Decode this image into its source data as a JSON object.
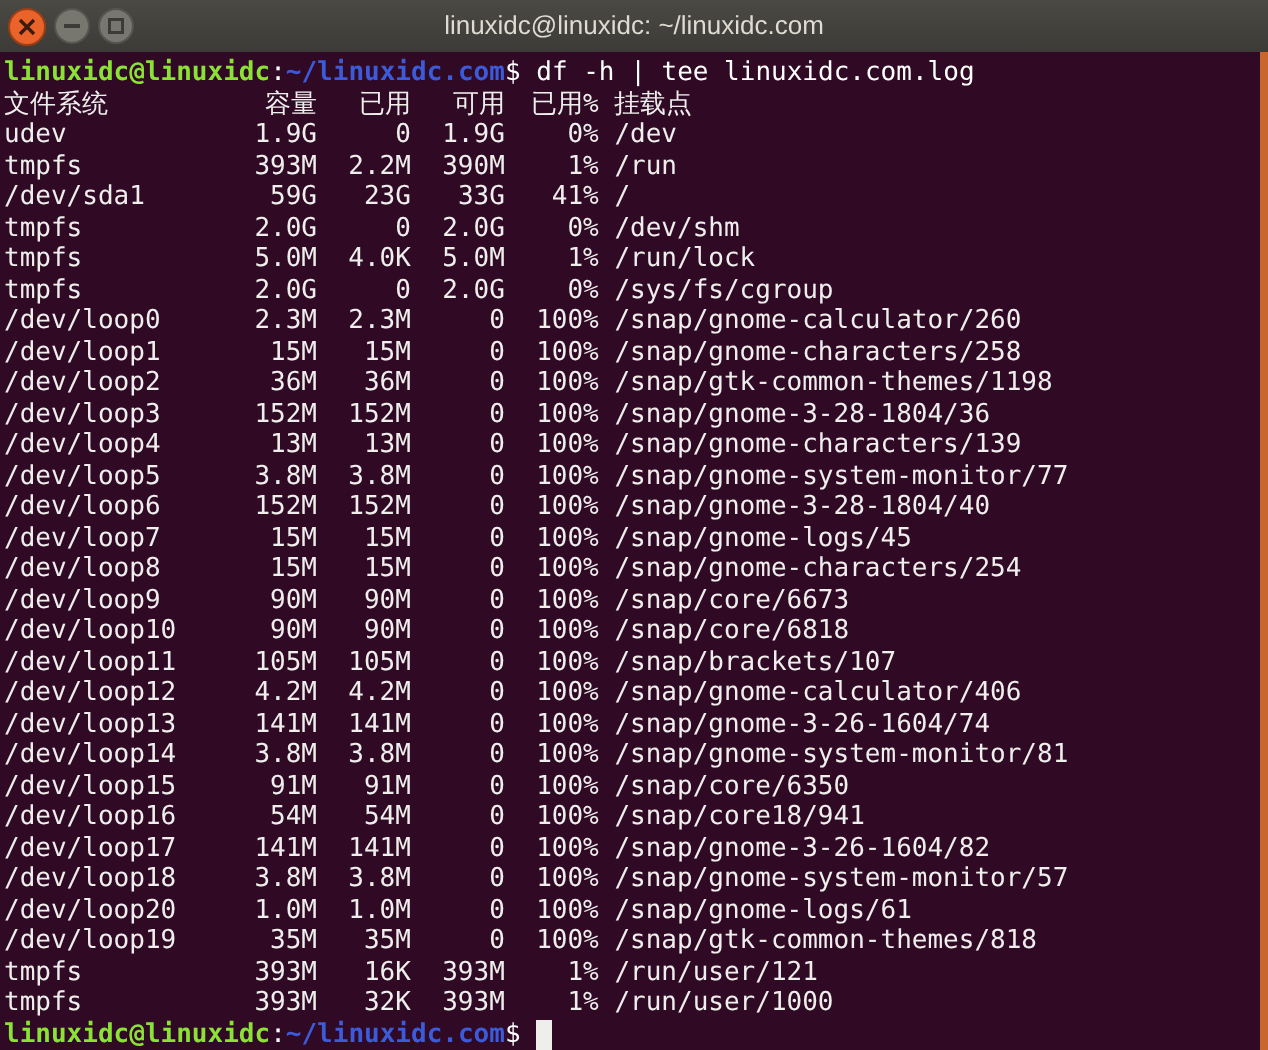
{
  "window": {
    "title": "linuxidc@linuxidc: ~/linuxidc.com"
  },
  "command": {
    "user_host": "linuxidc@linuxidc",
    "separator": ":",
    "path": "~/linuxidc.com",
    "prompt_sign": "$",
    "text": " df -h | tee linuxidc.com.log"
  },
  "table": {
    "columns": [
      "文件系统",
      "容量",
      "已用",
      "可用",
      "已用%",
      "挂载点"
    ],
    "rows": [
      [
        "udev",
        "1.9G",
        "0",
        "1.9G",
        "0%",
        "/dev"
      ],
      [
        "tmpfs",
        "393M",
        "2.2M",
        "390M",
        "1%",
        "/run"
      ],
      [
        "/dev/sda1",
        "59G",
        "23G",
        "33G",
        "41%",
        "/"
      ],
      [
        "tmpfs",
        "2.0G",
        "0",
        "2.0G",
        "0%",
        "/dev/shm"
      ],
      [
        "tmpfs",
        "5.0M",
        "4.0K",
        "5.0M",
        "1%",
        "/run/lock"
      ],
      [
        "tmpfs",
        "2.0G",
        "0",
        "2.0G",
        "0%",
        "/sys/fs/cgroup"
      ],
      [
        "/dev/loop0",
        "2.3M",
        "2.3M",
        "0",
        "100%",
        "/snap/gnome-calculator/260"
      ],
      [
        "/dev/loop1",
        "15M",
        "15M",
        "0",
        "100%",
        "/snap/gnome-characters/258"
      ],
      [
        "/dev/loop2",
        "36M",
        "36M",
        "0",
        "100%",
        "/snap/gtk-common-themes/1198"
      ],
      [
        "/dev/loop3",
        "152M",
        "152M",
        "0",
        "100%",
        "/snap/gnome-3-28-1804/36"
      ],
      [
        "/dev/loop4",
        "13M",
        "13M",
        "0",
        "100%",
        "/snap/gnome-characters/139"
      ],
      [
        "/dev/loop5",
        "3.8M",
        "3.8M",
        "0",
        "100%",
        "/snap/gnome-system-monitor/77"
      ],
      [
        "/dev/loop6",
        "152M",
        "152M",
        "0",
        "100%",
        "/snap/gnome-3-28-1804/40"
      ],
      [
        "/dev/loop7",
        "15M",
        "15M",
        "0",
        "100%",
        "/snap/gnome-logs/45"
      ],
      [
        "/dev/loop8",
        "15M",
        "15M",
        "0",
        "100%",
        "/snap/gnome-characters/254"
      ],
      [
        "/dev/loop9",
        "90M",
        "90M",
        "0",
        "100%",
        "/snap/core/6673"
      ],
      [
        "/dev/loop10",
        "90M",
        "90M",
        "0",
        "100%",
        "/snap/core/6818"
      ],
      [
        "/dev/loop11",
        "105M",
        "105M",
        "0",
        "100%",
        "/snap/brackets/107"
      ],
      [
        "/dev/loop12",
        "4.2M",
        "4.2M",
        "0",
        "100%",
        "/snap/gnome-calculator/406"
      ],
      [
        "/dev/loop13",
        "141M",
        "141M",
        "0",
        "100%",
        "/snap/gnome-3-26-1604/74"
      ],
      [
        "/dev/loop14",
        "3.8M",
        "3.8M",
        "0",
        "100%",
        "/snap/gnome-system-monitor/81"
      ],
      [
        "/dev/loop15",
        "91M",
        "91M",
        "0",
        "100%",
        "/snap/core/6350"
      ],
      [
        "/dev/loop16",
        "54M",
        "54M",
        "0",
        "100%",
        "/snap/core18/941"
      ],
      [
        "/dev/loop17",
        "141M",
        "141M",
        "0",
        "100%",
        "/snap/gnome-3-26-1604/82"
      ],
      [
        "/dev/loop18",
        "3.8M",
        "3.8M",
        "0",
        "100%",
        "/snap/gnome-system-monitor/57"
      ],
      [
        "/dev/loop20",
        "1.0M",
        "1.0M",
        "0",
        "100%",
        "/snap/gnome-logs/61"
      ],
      [
        "/dev/loop19",
        "35M",
        "35M",
        "0",
        "100%",
        "/snap/gtk-common-themes/818"
      ],
      [
        "tmpfs",
        "393M",
        "16K",
        "393M",
        "1%",
        "/run/user/121"
      ],
      [
        "tmpfs",
        "393M",
        "32K",
        "393M",
        "1%",
        "/run/user/1000"
      ]
    ]
  },
  "final_prompt": {
    "user_host": "linuxidc@linuxidc",
    "separator": ":",
    "path": "~/linuxidc.com",
    "prompt_sign": "$"
  }
}
